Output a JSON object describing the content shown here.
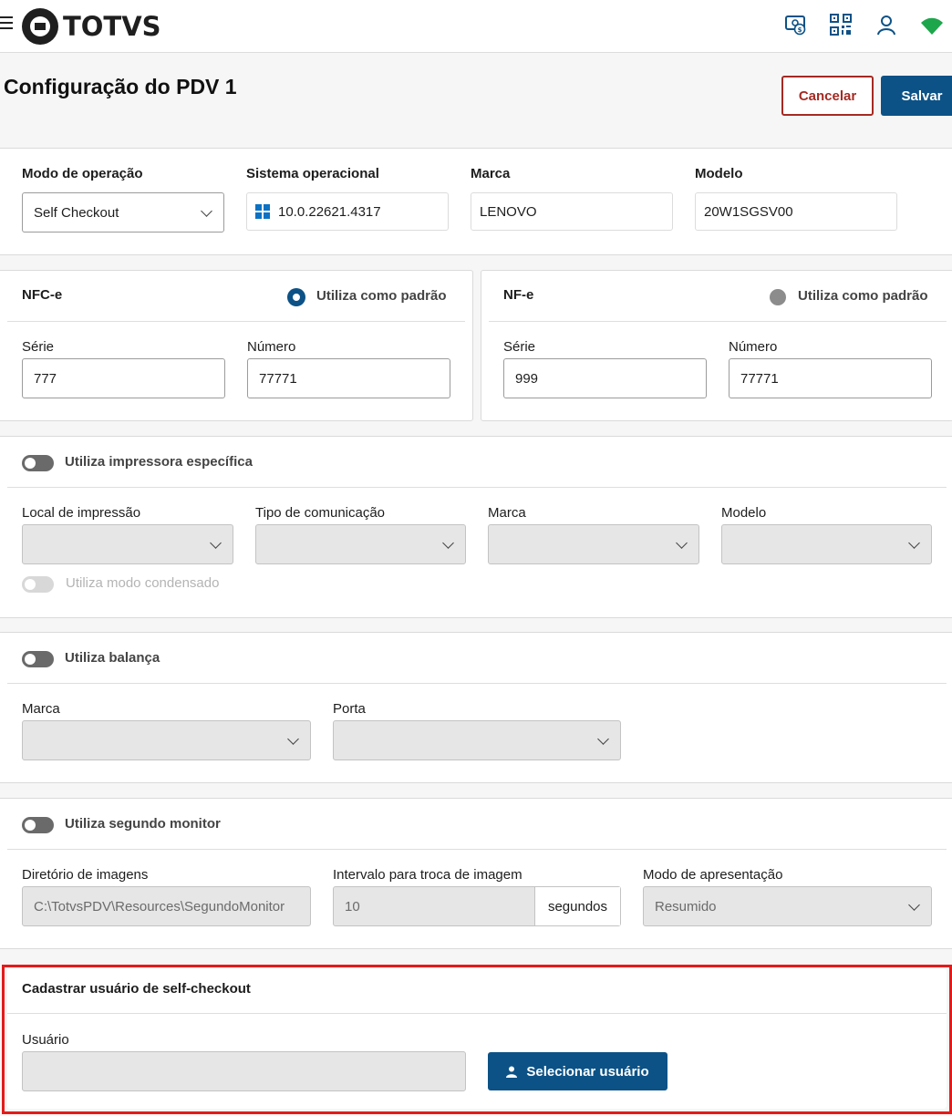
{
  "header": {
    "logo_text": "TOTVS",
    "icons": [
      "menu-icon",
      "money-sync-icon",
      "qr-code-icon",
      "user-icon",
      "wifi-icon"
    ]
  },
  "page": {
    "title": "Configuração do PDV 1",
    "cancel_label": "Cancelar",
    "save_label": "Salvar"
  },
  "device": {
    "mode_label": "Modo de operação",
    "mode_value": "Self Checkout",
    "os_label": "Sistema operacional",
    "os_value": "10.0.22621.4317",
    "brand_label": "Marca",
    "brand_value": "LENOVO",
    "model_label": "Modelo",
    "model_value": "20W1SGSV00"
  },
  "nfce": {
    "title": "NFC-e",
    "default_label": "Utiliza como padrão",
    "default_selected": true,
    "serie_label": "Série",
    "serie_value": "777",
    "numero_label": "Número",
    "numero_value": "77771"
  },
  "nfe": {
    "title": "NF-e",
    "default_label": "Utiliza como padrão",
    "default_selected": false,
    "serie_label": "Série",
    "serie_value": "999",
    "numero_label": "Número",
    "numero_value": "77771"
  },
  "printer": {
    "toggle_label": "Utiliza impressora específica",
    "local_label": "Local de impressão",
    "comm_label": "Tipo de comunicação",
    "brand_label": "Marca",
    "model_label": "Modelo",
    "condensed_label": "Utiliza modo condensado"
  },
  "scale": {
    "toggle_label": "Utiliza balança",
    "brand_label": "Marca",
    "port_label": "Porta"
  },
  "monitor": {
    "toggle_label": "Utiliza segundo monitor",
    "dir_label": "Diretório de imagens",
    "dir_value": "C:\\TotvsPDV\\Resources\\SegundoMonitor",
    "interval_label": "Intervalo para troca de imagem",
    "interval_value": "10",
    "interval_unit": "segundos",
    "mode_label": "Modo de apresentação",
    "mode_value": "Resumido"
  },
  "selfcheckout": {
    "title": "Cadastrar usuário de self-checkout",
    "user_label": "Usuário",
    "user_value": "",
    "select_button": "Selecionar usuário"
  },
  "colors": {
    "primary": "#0c5286",
    "danger": "#a42a23",
    "highlight": "#e31b1b"
  }
}
